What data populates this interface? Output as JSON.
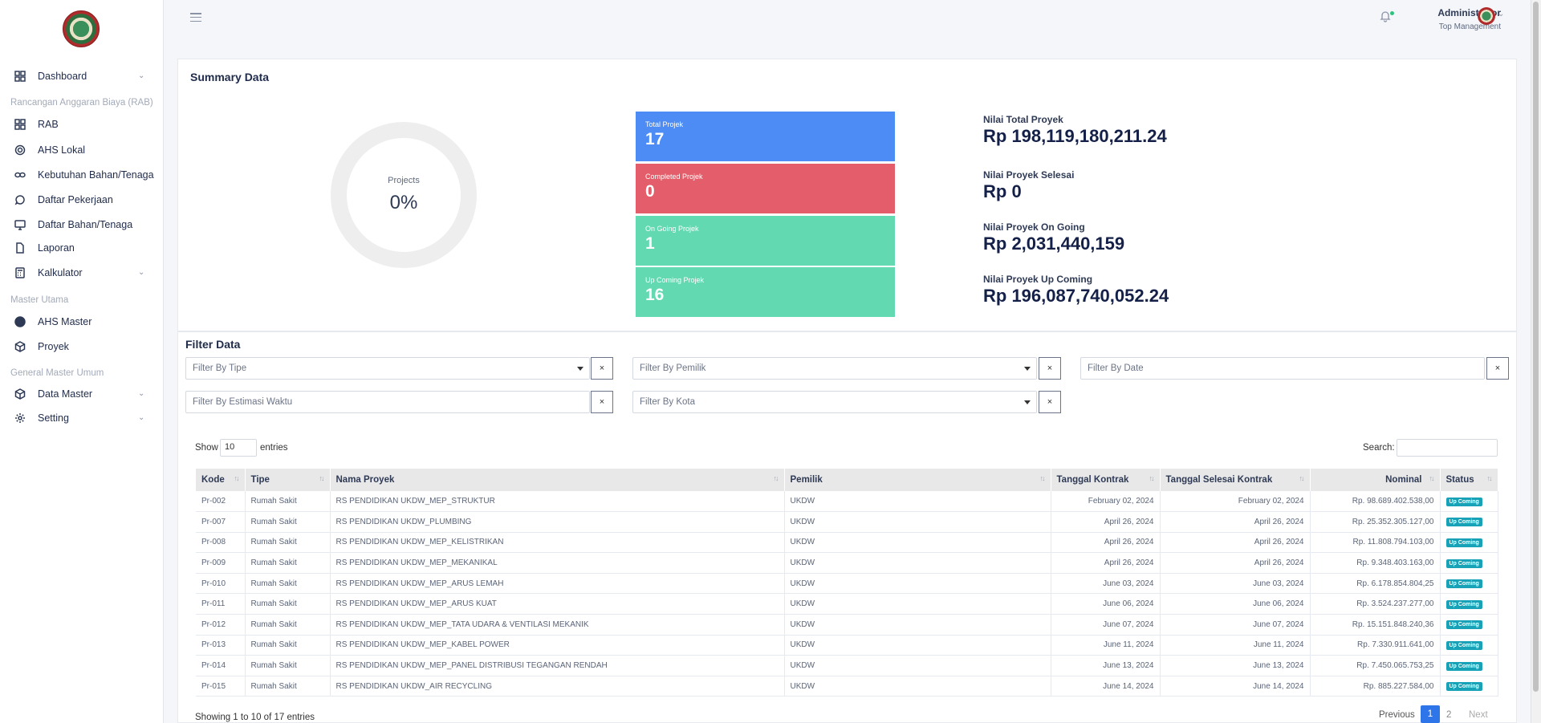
{
  "sidebar": {
    "items": [
      {
        "label": "Dashboard",
        "icon": "grid-icon",
        "has_chevron": true
      },
      {
        "label": "RAB",
        "icon": "grid-icon"
      },
      {
        "label": "AHS Lokal",
        "icon": "settings-gear-icon"
      },
      {
        "label": "Kebutuhan Bahan/Tenaga",
        "icon": "infinity-icon"
      },
      {
        "label": "Daftar Pekerjaan",
        "icon": "chat-bubble-icon"
      },
      {
        "label": "Daftar Bahan/Tenaga",
        "icon": "monitor-icon"
      },
      {
        "label": "Laporan",
        "icon": "file-icon"
      },
      {
        "label": "Kalkulator",
        "icon": "calculator-icon",
        "has_chevron": true
      },
      {
        "label": "AHS Master",
        "icon": "globe-icon"
      },
      {
        "label": "Proyek",
        "icon": "box-icon"
      },
      {
        "label": "Data Master",
        "icon": "box-icon",
        "has_chevron": true
      },
      {
        "label": "Setting",
        "icon": "gear-icon",
        "has_chevron": true
      }
    ],
    "sections": {
      "rab": "Rancangan Anggaran Biaya (RAB)",
      "master": "Master Utama",
      "general": "General Master Umum"
    }
  },
  "header": {
    "user_name": "Administrator",
    "user_role": "Top Management"
  },
  "summary": {
    "title": "Summary Data",
    "donut_label": "Projects",
    "donut_value": "0%",
    "stats": [
      {
        "label": "Total Projek",
        "value": "17",
        "color": "#4d8cf5"
      },
      {
        "label": "Completed Projek",
        "value": "0",
        "color": "#e35d6a"
      },
      {
        "label": "On Going Projek",
        "value": "1",
        "color": "#63d9b2"
      },
      {
        "label": "Up Coming Projek",
        "value": "16",
        "color": "#63d9b2"
      }
    ],
    "nilai": [
      {
        "label": "Nilai Total Proyek",
        "value": "Rp 198,119,180,211.24"
      },
      {
        "label": "Nilai Proyek Selesai",
        "value": "Rp 0"
      },
      {
        "label": "Nilai Proyek On Going",
        "value": "Rp 2,031,440,159"
      },
      {
        "label": "Nilai Proyek Up Coming",
        "value": "Rp 196,087,740,052.24"
      }
    ]
  },
  "filter": {
    "title": "Filter Data",
    "tipe": "Filter By Tipe",
    "pemilik": "Filter By Pemilik",
    "date": "Filter By Date",
    "estimasi": "Filter By Estimasi Waktu",
    "kota": "Filter By Kota",
    "clear": "×"
  },
  "table": {
    "show_label": "Show",
    "show_value": "10",
    "entries_label": "entries",
    "search_label": "Search:",
    "columns": [
      "Kode",
      "Tipe",
      "Nama Proyek",
      "Pemilik",
      "Tanggal Kontrak",
      "Tanggal Selesai Kontrak",
      "Nominal",
      "Status"
    ],
    "rows": [
      [
        "Pr-002",
        "Rumah Sakit",
        "RS PENDIDIKAN UKDW_MEP_STRUKTUR",
        "UKDW",
        "February 02, 2024",
        "February 02, 2024",
        "Rp. 98.689.402.538,00",
        "Up Coming"
      ],
      [
        "Pr-007",
        "Rumah Sakit",
        "RS PENDIDIKAN UKDW_PLUMBING",
        "UKDW",
        "April 26, 2024",
        "April 26, 2024",
        "Rp. 25.352.305.127,00",
        "Up Coming"
      ],
      [
        "Pr-008",
        "Rumah Sakit",
        "RS PENDIDIKAN UKDW_MEP_KELISTRIKAN",
        "UKDW",
        "April 26, 2024",
        "April 26, 2024",
        "Rp. 11.808.794.103,00",
        "Up Coming"
      ],
      [
        "Pr-009",
        "Rumah Sakit",
        "RS PENDIDIKAN UKDW_MEP_MEKANIKAL",
        "UKDW",
        "April 26, 2024",
        "April 26, 2024",
        "Rp. 9.348.403.163,00",
        "Up Coming"
      ],
      [
        "Pr-010",
        "Rumah Sakit",
        "RS PENDIDIKAN UKDW_MEP_ARUS LEMAH",
        "UKDW",
        "June 03, 2024",
        "June 03, 2024",
        "Rp. 6.178.854.804,25",
        "Up Coming"
      ],
      [
        "Pr-011",
        "Rumah Sakit",
        "RS PENDIDIKAN UKDW_MEP_ARUS KUAT",
        "UKDW",
        "June 06, 2024",
        "June 06, 2024",
        "Rp. 3.524.237.277,00",
        "Up Coming"
      ],
      [
        "Pr-012",
        "Rumah Sakit",
        "RS PENDIDIKAN UKDW_MEP_TATA UDARA & VENTILASI MEKANIK",
        "UKDW",
        "June 07, 2024",
        "June 07, 2024",
        "Rp. 15.151.848.240,36",
        "Up Coming"
      ],
      [
        "Pr-013",
        "Rumah Sakit",
        "RS PENDIDIKAN UKDW_MEP_KABEL POWER",
        "UKDW",
        "June 11, 2024",
        "June 11, 2024",
        "Rp. 7.330.911.641,00",
        "Up Coming"
      ],
      [
        "Pr-014",
        "Rumah Sakit",
        "RS PENDIDIKAN UKDW_MEP_PANEL DISTRIBUSI TEGANGAN RENDAH",
        "UKDW",
        "June 13, 2024",
        "June 13, 2024",
        "Rp. 7.450.065.753,25",
        "Up Coming"
      ],
      [
        "Pr-015",
        "Rumah Sakit",
        "RS PENDIDIKAN UKDW_AIR RECYCLING",
        "UKDW",
        "June 14, 2024",
        "June 14, 2024",
        "Rp. 885.227.584,00",
        "Up Coming"
      ]
    ],
    "showing": "Showing 1 to 10 of 17 entries",
    "pagination": {
      "previous": "Previous",
      "pages": [
        "1",
        "2"
      ],
      "next": "Next"
    }
  },
  "colors": {
    "primary": "#2f75ea",
    "badge": "#17a2b8"
  }
}
